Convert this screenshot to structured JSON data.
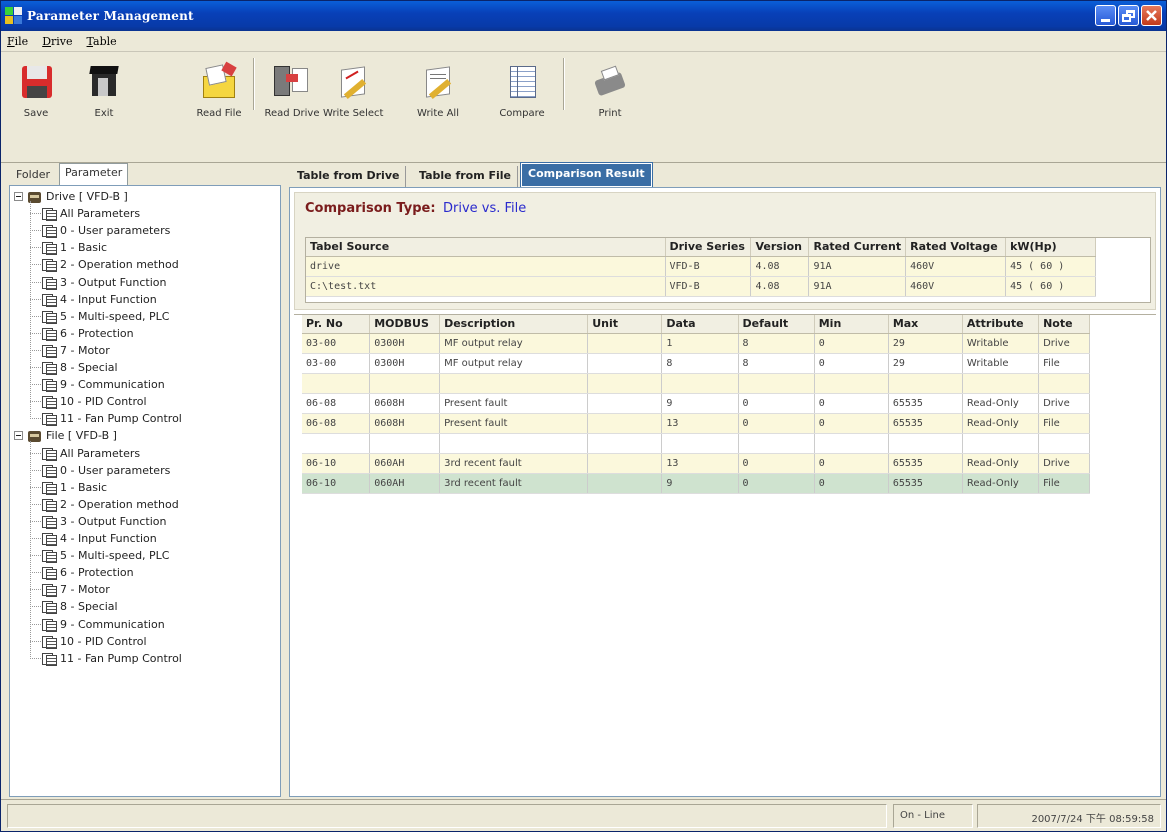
{
  "window": {
    "title": "Parameter Management"
  },
  "menu": [
    "File",
    "Drive",
    "Table"
  ],
  "toolbar": {
    "save": "Save",
    "exit": "Exit",
    "read_file": "Read File",
    "read_drive": "Read Drive",
    "write_select": "Write Select",
    "write_all": "Write All",
    "compare": "Compare",
    "print": "Print"
  },
  "left_tabs": [
    "Folder",
    "Parameter"
  ],
  "tree": {
    "drive_root": "Drive [ VFD-B ]",
    "file_root": "File [ VFD-B ]",
    "drive_items": [
      "All Parameters",
      "0 - User parameters",
      "1 - Basic",
      "2 - Operation method",
      "3 - Output Function",
      "4 - Input Function",
      "5 - Multi-speed, PLC",
      "6 - Protection",
      "7 - Motor",
      "8 - Special",
      "9 - Communication",
      "10 - PID Control",
      "11 - Fan Pump Control"
    ],
    "file_items": [
      "All Parameters",
      "0 - User parameters",
      "1 - Basic",
      "2 - Operation method",
      "3 - Output Function",
      "4 - Input Function",
      "5 - Multi-speed, PLC",
      "6 - Protection",
      "7 - Motor",
      "8 - Special",
      "9 - Communication",
      "10 - PID Control",
      "11 - Fan Pump Control"
    ]
  },
  "right_tabs": [
    "Table from Drive",
    "Table from File",
    "Comparison Result"
  ],
  "comparison": {
    "label": "Comparison Type:",
    "value": "Drive vs. File"
  },
  "source_table": {
    "headers": [
      "Tabel Source",
      "Drive Series",
      "Version",
      "Rated Current",
      "Rated Voltage",
      "kW(Hp)"
    ],
    "rows": [
      [
        "drive",
        "VFD-B",
        "4.08",
        "91A",
        "460V",
        "45 ( 60 )"
      ],
      [
        "C:\\test.txt",
        "VFD-B",
        "4.08",
        "91A",
        "460V",
        "45 ( 60 )"
      ]
    ]
  },
  "data_table": {
    "headers": [
      "Pr. No",
      "MODBUS",
      "Description",
      "Unit",
      "Data",
      "Default",
      "Min",
      "Max",
      "Attribute",
      "Note"
    ],
    "rows": [
      [
        "03-00",
        "0300H",
        "MF output relay",
        "",
        "1",
        "8",
        "0",
        "29",
        "Writable",
        "Drive"
      ],
      [
        "03-00",
        "0300H",
        "MF output relay",
        "",
        "8",
        "8",
        "0",
        "29",
        "Writable",
        "File"
      ],
      [
        "",
        "",
        "",
        "",
        "",
        "",
        "",
        "",
        "",
        ""
      ],
      [
        "06-08",
        "0608H",
        "Present fault",
        "",
        "9",
        "0",
        "0",
        "65535",
        "Read-Only",
        "Drive"
      ],
      [
        "06-08",
        "0608H",
        "Present fault",
        "",
        "13",
        "0",
        "0",
        "65535",
        "Read-Only",
        "File"
      ],
      [
        "",
        "",
        "",
        "",
        "",
        "",
        "",
        "",
        "",
        ""
      ],
      [
        "06-10",
        "060AH",
        "3rd recent fault",
        "",
        "13",
        "0",
        "0",
        "65535",
        "Read-Only",
        "Drive"
      ],
      [
        "06-10",
        "060AH",
        "3rd recent fault",
        "",
        "9",
        "0",
        "0",
        "65535",
        "Read-Only",
        "File"
      ]
    ],
    "row_styles": [
      "y",
      "w",
      "y",
      "w",
      "y",
      "w",
      "y",
      "g"
    ]
  },
  "status": {
    "mode": "On - Line",
    "datetime": "2007/7/24 下午 08:59:58"
  },
  "colors": {
    "titlebar": "#0840b8",
    "active_tab": "#3a6ea5",
    "row_highlight": "#fbf8dc",
    "row_selected": "#cfe3cf",
    "comparison_label": "#7a1c1c",
    "comparison_value": "#2a2acd"
  }
}
